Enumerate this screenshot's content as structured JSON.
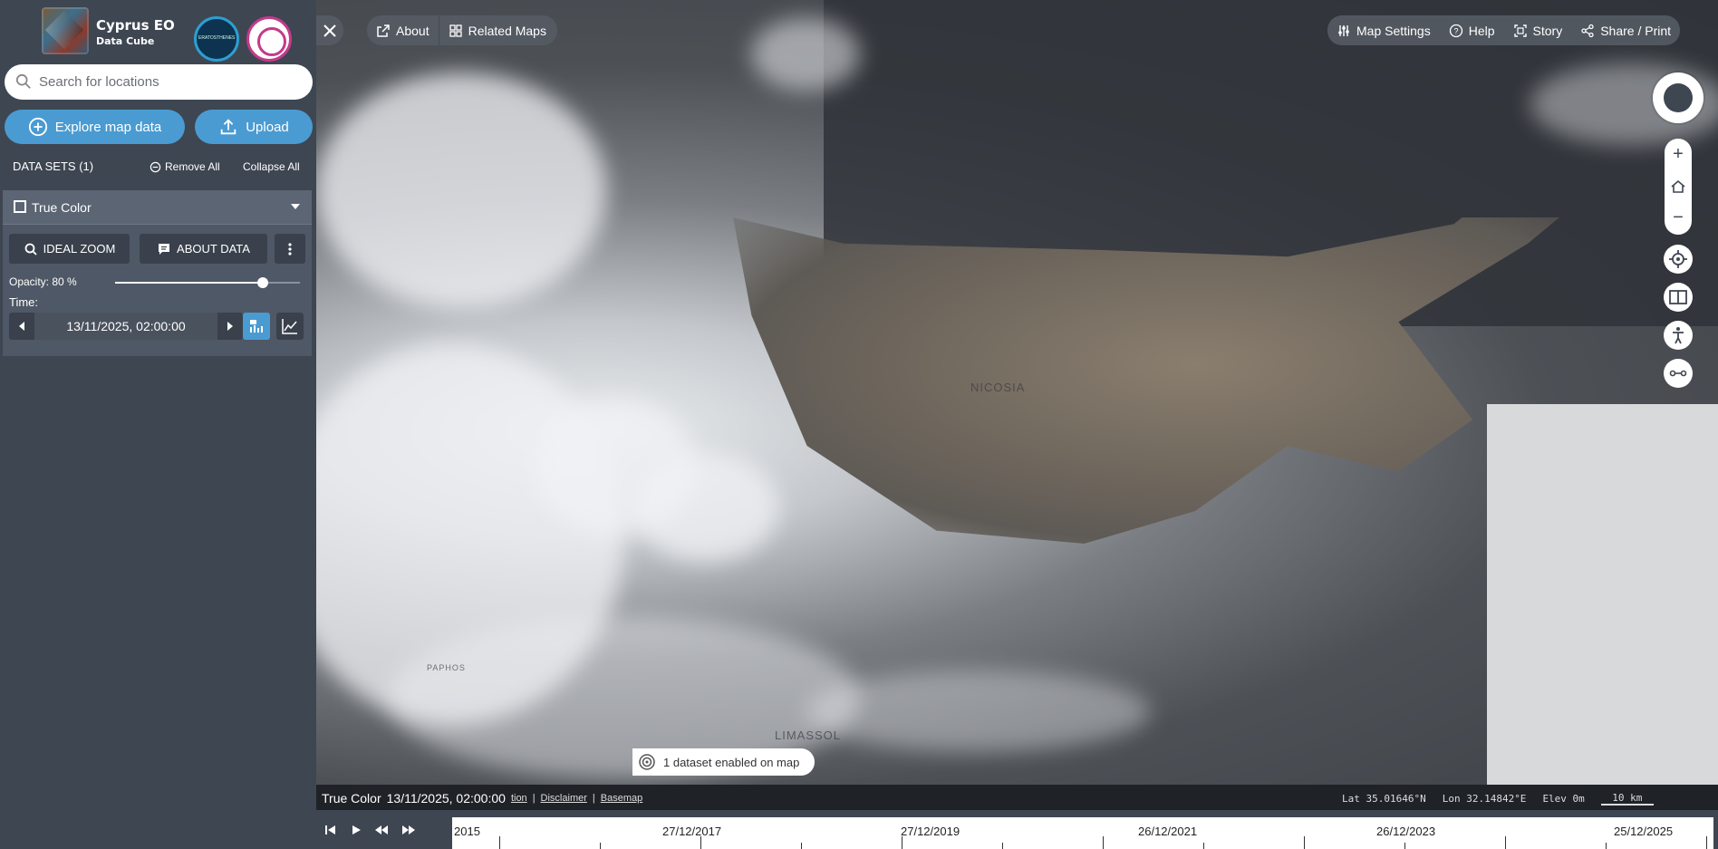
{
  "app": {
    "title": "Cyprus EO",
    "subtitle": "Data Cube",
    "partner1_text": "ERATOSTHENES"
  },
  "search": {
    "placeholder": "Search for locations"
  },
  "actions": {
    "explore_label": "Explore map data",
    "upload_label": "Upload"
  },
  "datasets": {
    "header": "DATA SETS (1)",
    "remove_all": "Remove All",
    "collapse_all": "Collapse All",
    "items": [
      {
        "name": "True Color",
        "ideal_zoom": "IDEAL ZOOM",
        "about_data": "ABOUT DATA",
        "opacity_label": "Opacity: 80 %",
        "opacity_value": 0.8,
        "time_label": "Time:",
        "time_value": "13/11/2025, 02:00:00"
      }
    ]
  },
  "top_nav": {
    "about": "About",
    "related_maps": "Related Maps",
    "map_settings": "Map Settings",
    "help": "Help",
    "story": "Story",
    "share_print": "Share / Print"
  },
  "map": {
    "labels": [
      "NICOSIA",
      "LIMASSOL",
      "PAPHOS"
    ],
    "enabled_status": "1 dataset enabled on map"
  },
  "info_bar": {
    "dataset": "True Color",
    "datetime": "13/11/2025, 02:00:00",
    "attribution_link": "tion",
    "disclaimer": "Disclaimer",
    "basemap": "Basemap",
    "lat": "Lat  35.01646°N",
    "lon": "Lon  32.14842°E",
    "elev": "Elev  0m",
    "scale": "10 km"
  },
  "timeline": {
    "labels": [
      "2015",
      "27/12/2017",
      "27/12/2019",
      "26/12/2021",
      "26/12/2023",
      "25/12/2025"
    ]
  },
  "colors": {
    "sidebar_bg": "#3e4652",
    "accent": "#4a9bd2",
    "card_bg": "#5b6574"
  },
  "icons": {
    "search": "search-icon",
    "explore": "plus-circle-icon",
    "upload": "upload-icon",
    "remove_all": "minus-circle-icon"
  }
}
